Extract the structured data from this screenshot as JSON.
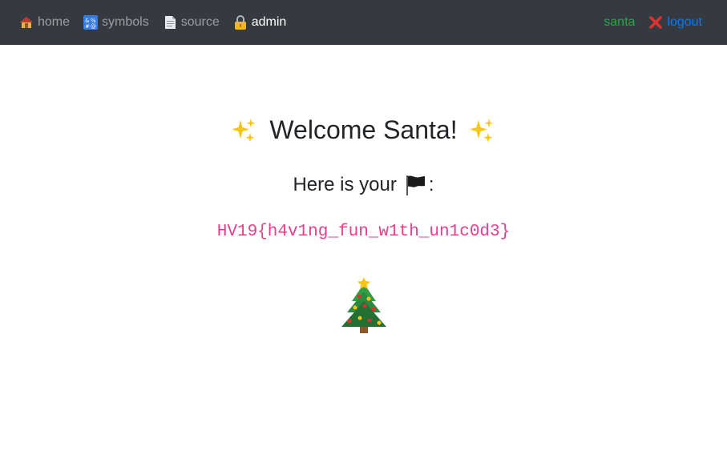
{
  "nav": {
    "items": [
      {
        "label": "home",
        "icon": "house-icon"
      },
      {
        "label": "symbols",
        "icon": "symbols-icon"
      },
      {
        "label": "source",
        "icon": "page-icon"
      },
      {
        "label": "admin",
        "icon": "lock-icon",
        "active": true
      }
    ],
    "username": "santa",
    "logout_label": "logout",
    "logout_icon": "cross-mark-icon"
  },
  "main": {
    "title": "Welcome Santa!",
    "flag_intro": "Here is your",
    "flag_suffix": ":",
    "flag_icon": "black-flag-icon",
    "flag_value": "HV19{h4v1ng_fun_w1th_un1c0d3}",
    "tree_icon": "christmas-tree-icon"
  },
  "colors": {
    "navbar_bg": "#343a40",
    "username": "#28a745",
    "logout": "#007bff",
    "flag_value": "#e83e8c",
    "sparkle": "#f5c518"
  }
}
